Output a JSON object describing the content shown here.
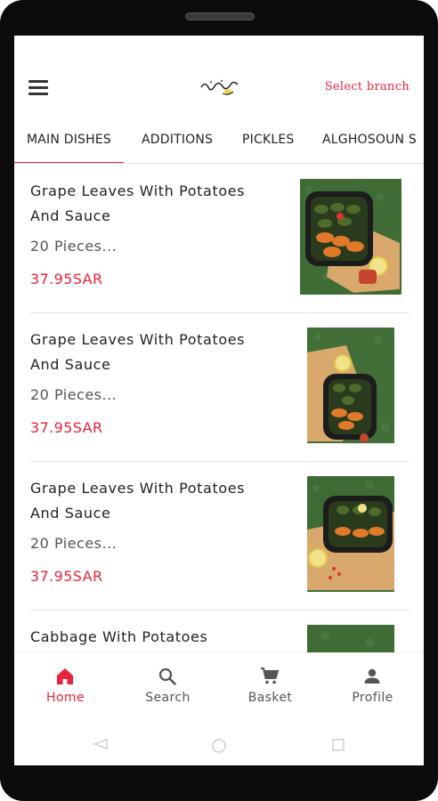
{
  "header": {
    "select_branch": "Select branch",
    "logo_alt": "logo"
  },
  "tabs": [
    {
      "label": "MAIN DISHES",
      "active": true
    },
    {
      "label": "ADDITIONS",
      "active": false
    },
    {
      "label": "PICKLES",
      "active": false
    },
    {
      "label": "ALGHOSOUN S",
      "active": false
    }
  ],
  "items": [
    {
      "name": "Grape Leaves With Potatoes And Sauce",
      "description": "20 Pieces...",
      "price": "37.95SAR",
      "image_icon": "food-photo-icon"
    },
    {
      "name": "Grape Leaves With Potatoes And Sauce",
      "description": "20 Pieces...",
      "price": "37.95SAR",
      "image_icon": "food-photo-icon"
    },
    {
      "name": "Grape Leaves With Potatoes And Sauce",
      "description": "20 Pieces...",
      "price": "37.95SAR",
      "image_icon": "food-photo-icon"
    },
    {
      "name": "Cabbage With Potatoes",
      "description": "",
      "price": "",
      "image_icon": "food-photo-icon"
    }
  ],
  "bottom_nav": [
    {
      "label": "Home",
      "icon": "home-icon",
      "active": true
    },
    {
      "label": "Search",
      "icon": "search-icon",
      "active": false
    },
    {
      "label": "Basket",
      "icon": "cart-icon",
      "active": false
    },
    {
      "label": "Profile",
      "icon": "person-icon",
      "active": false
    }
  ],
  "colors": {
    "accent": "#e8233d",
    "text": "#222222",
    "muted": "#555555"
  }
}
